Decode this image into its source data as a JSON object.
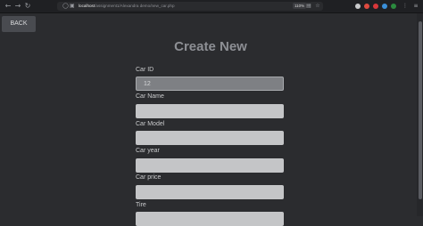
{
  "browser": {
    "url_host": "localhost",
    "url_path": "/assignment1/Alexandra demo/new_car.php",
    "zoom": "110%",
    "icons": {
      "back": "arrow-left-icon",
      "forward": "arrow-right-icon",
      "reload": "reload-icon",
      "shield": "shield-icon",
      "lock": "page-info-icon",
      "reader": "reader-view-icon",
      "bookmark": "star-icon"
    },
    "ext_colors": [
      "#c9cacc",
      "#e04a3f",
      "#d9373a",
      "#3a8fd9",
      "#2b8a3e"
    ]
  },
  "page": {
    "back_label": "BACK",
    "title": "Create New",
    "fields": [
      {
        "label": "Car ID",
        "value": "12",
        "placeholder": ""
      },
      {
        "label": "Car Name",
        "value": "",
        "placeholder": ""
      },
      {
        "label": "Car Model",
        "value": "",
        "placeholder": ""
      },
      {
        "label": "Car year",
        "value": "",
        "placeholder": ""
      },
      {
        "label": "Car price",
        "value": "",
        "placeholder": ""
      },
      {
        "label": "Tire",
        "value": "",
        "placeholder": ""
      }
    ]
  }
}
